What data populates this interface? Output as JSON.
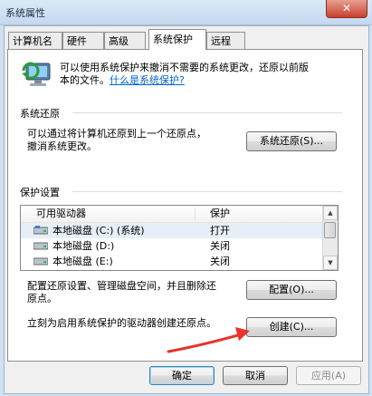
{
  "window": {
    "title": "系统属性",
    "close_symbol": "✕"
  },
  "tabs": [
    {
      "label": "计算机名"
    },
    {
      "label": "硬件"
    },
    {
      "label": "高级"
    },
    {
      "label": "系统保护"
    },
    {
      "label": "远程"
    }
  ],
  "intro": {
    "line1": "可以使用系统保护来撤消不需要的系统更改，还原以前版",
    "line2_prefix": "本的文件。",
    "link": "什么是系统保护?"
  },
  "restore": {
    "title": "系统还原",
    "line1": "可以通过将计算机还原到上一个还原点，",
    "line2": "撤消系统更改。",
    "button": "系统还原(S)..."
  },
  "protection": {
    "title": "保护设置",
    "columns": [
      "可用驱动器",
      "保护"
    ],
    "rows": [
      {
        "drive": "本地磁盘 (C:) (系统)",
        "status": "打开"
      },
      {
        "drive": "本地磁盘 (D:)",
        "status": "关闭"
      },
      {
        "drive": "本地磁盘 (E:)",
        "status": "关闭"
      }
    ],
    "configure_line1": "配置还原设置、管理磁盘空间，并且删除还",
    "configure_line2": "原点。",
    "configure_button": "配置(O)...",
    "create_text": "立刻为启用系统保护的驱动器创建还原点。",
    "create_button": "创建(C)..."
  },
  "footer": {
    "ok": "确定",
    "cancel": "取消",
    "apply": "应用(A)"
  },
  "colors": {
    "annotation_arrow": "#e8322a",
    "link": "#0066cc"
  }
}
